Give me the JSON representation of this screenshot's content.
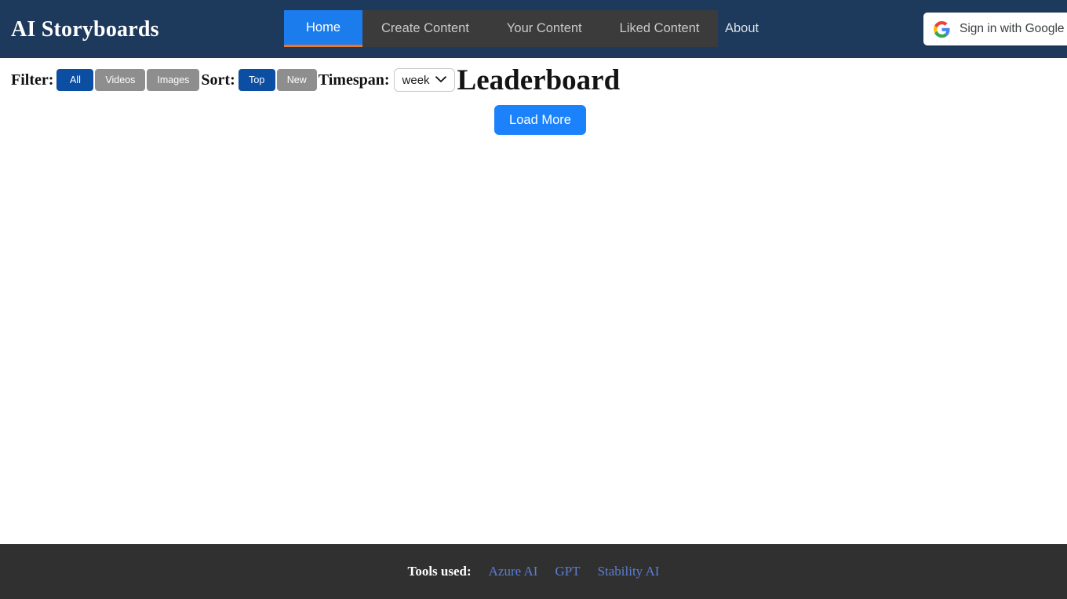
{
  "header": {
    "brand": "AI Storyboards",
    "nav": [
      {
        "label": "Home",
        "active": true
      },
      {
        "label": "Create Content",
        "active": false
      },
      {
        "label": "Your Content",
        "active": false
      },
      {
        "label": "Liked Content",
        "active": false
      }
    ],
    "about": "About",
    "sign_in": {
      "label": "Sign in with Google",
      "icon": "google-g-icon"
    },
    "colors": {
      "background": "#1d3a5c",
      "nav_band": "#3b3b3b",
      "active_tab": "#1b7ced",
      "active_underline": "#e8762c"
    }
  },
  "controls": {
    "filter_label": "Filter:",
    "filter_options": [
      {
        "label": "All",
        "active": true
      },
      {
        "label": "Videos",
        "active": false
      },
      {
        "label": "Images",
        "active": false
      }
    ],
    "sort_label": "Sort:",
    "sort_options": [
      {
        "label": "Top",
        "active": true
      },
      {
        "label": "New",
        "active": false
      }
    ],
    "timespan_label": "Timespan:",
    "timespan_value": "week",
    "timespan_icon": "chevron-down-icon",
    "colors": {
      "active_pill": "#0b4ea2",
      "inactive_pill": "#8e8e8e"
    }
  },
  "main": {
    "page_title": "Leaderboard",
    "load_more_label": "Load More",
    "load_more_color": "#1b82fc"
  },
  "footer": {
    "label": "Tools used:",
    "links": [
      {
        "label": "Azure AI"
      },
      {
        "label": "GPT"
      },
      {
        "label": "Stability AI"
      }
    ],
    "colors": {
      "background": "#303030",
      "link": "#5b7fd4"
    }
  }
}
